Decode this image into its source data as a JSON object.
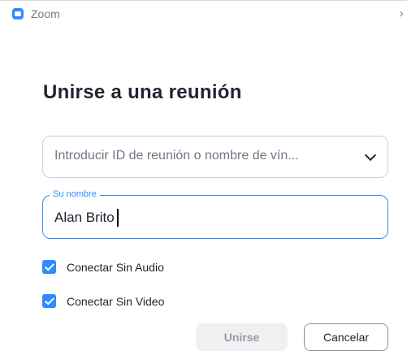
{
  "window": {
    "title": "Zoom",
    "app_icon": "zoom-camera-icon",
    "close_glyph": "›"
  },
  "heading": "Unirse a una reunión",
  "meeting_input": {
    "placeholder": "Introducir ID de reunión o nombre de vín...",
    "icon": "chevron-down-icon"
  },
  "name_input": {
    "label": "Su nombre",
    "value": "Alan Brito"
  },
  "options": [
    {
      "label": "Conectar Sin Audio",
      "checked": true
    },
    {
      "label": "Conectar Sin Video",
      "checked": true
    }
  ],
  "buttons": {
    "join": "Unirse",
    "cancel": "Cancelar"
  },
  "colors": {
    "accent": "#2d8cff",
    "disabled_button": "#f0f0f3"
  }
}
